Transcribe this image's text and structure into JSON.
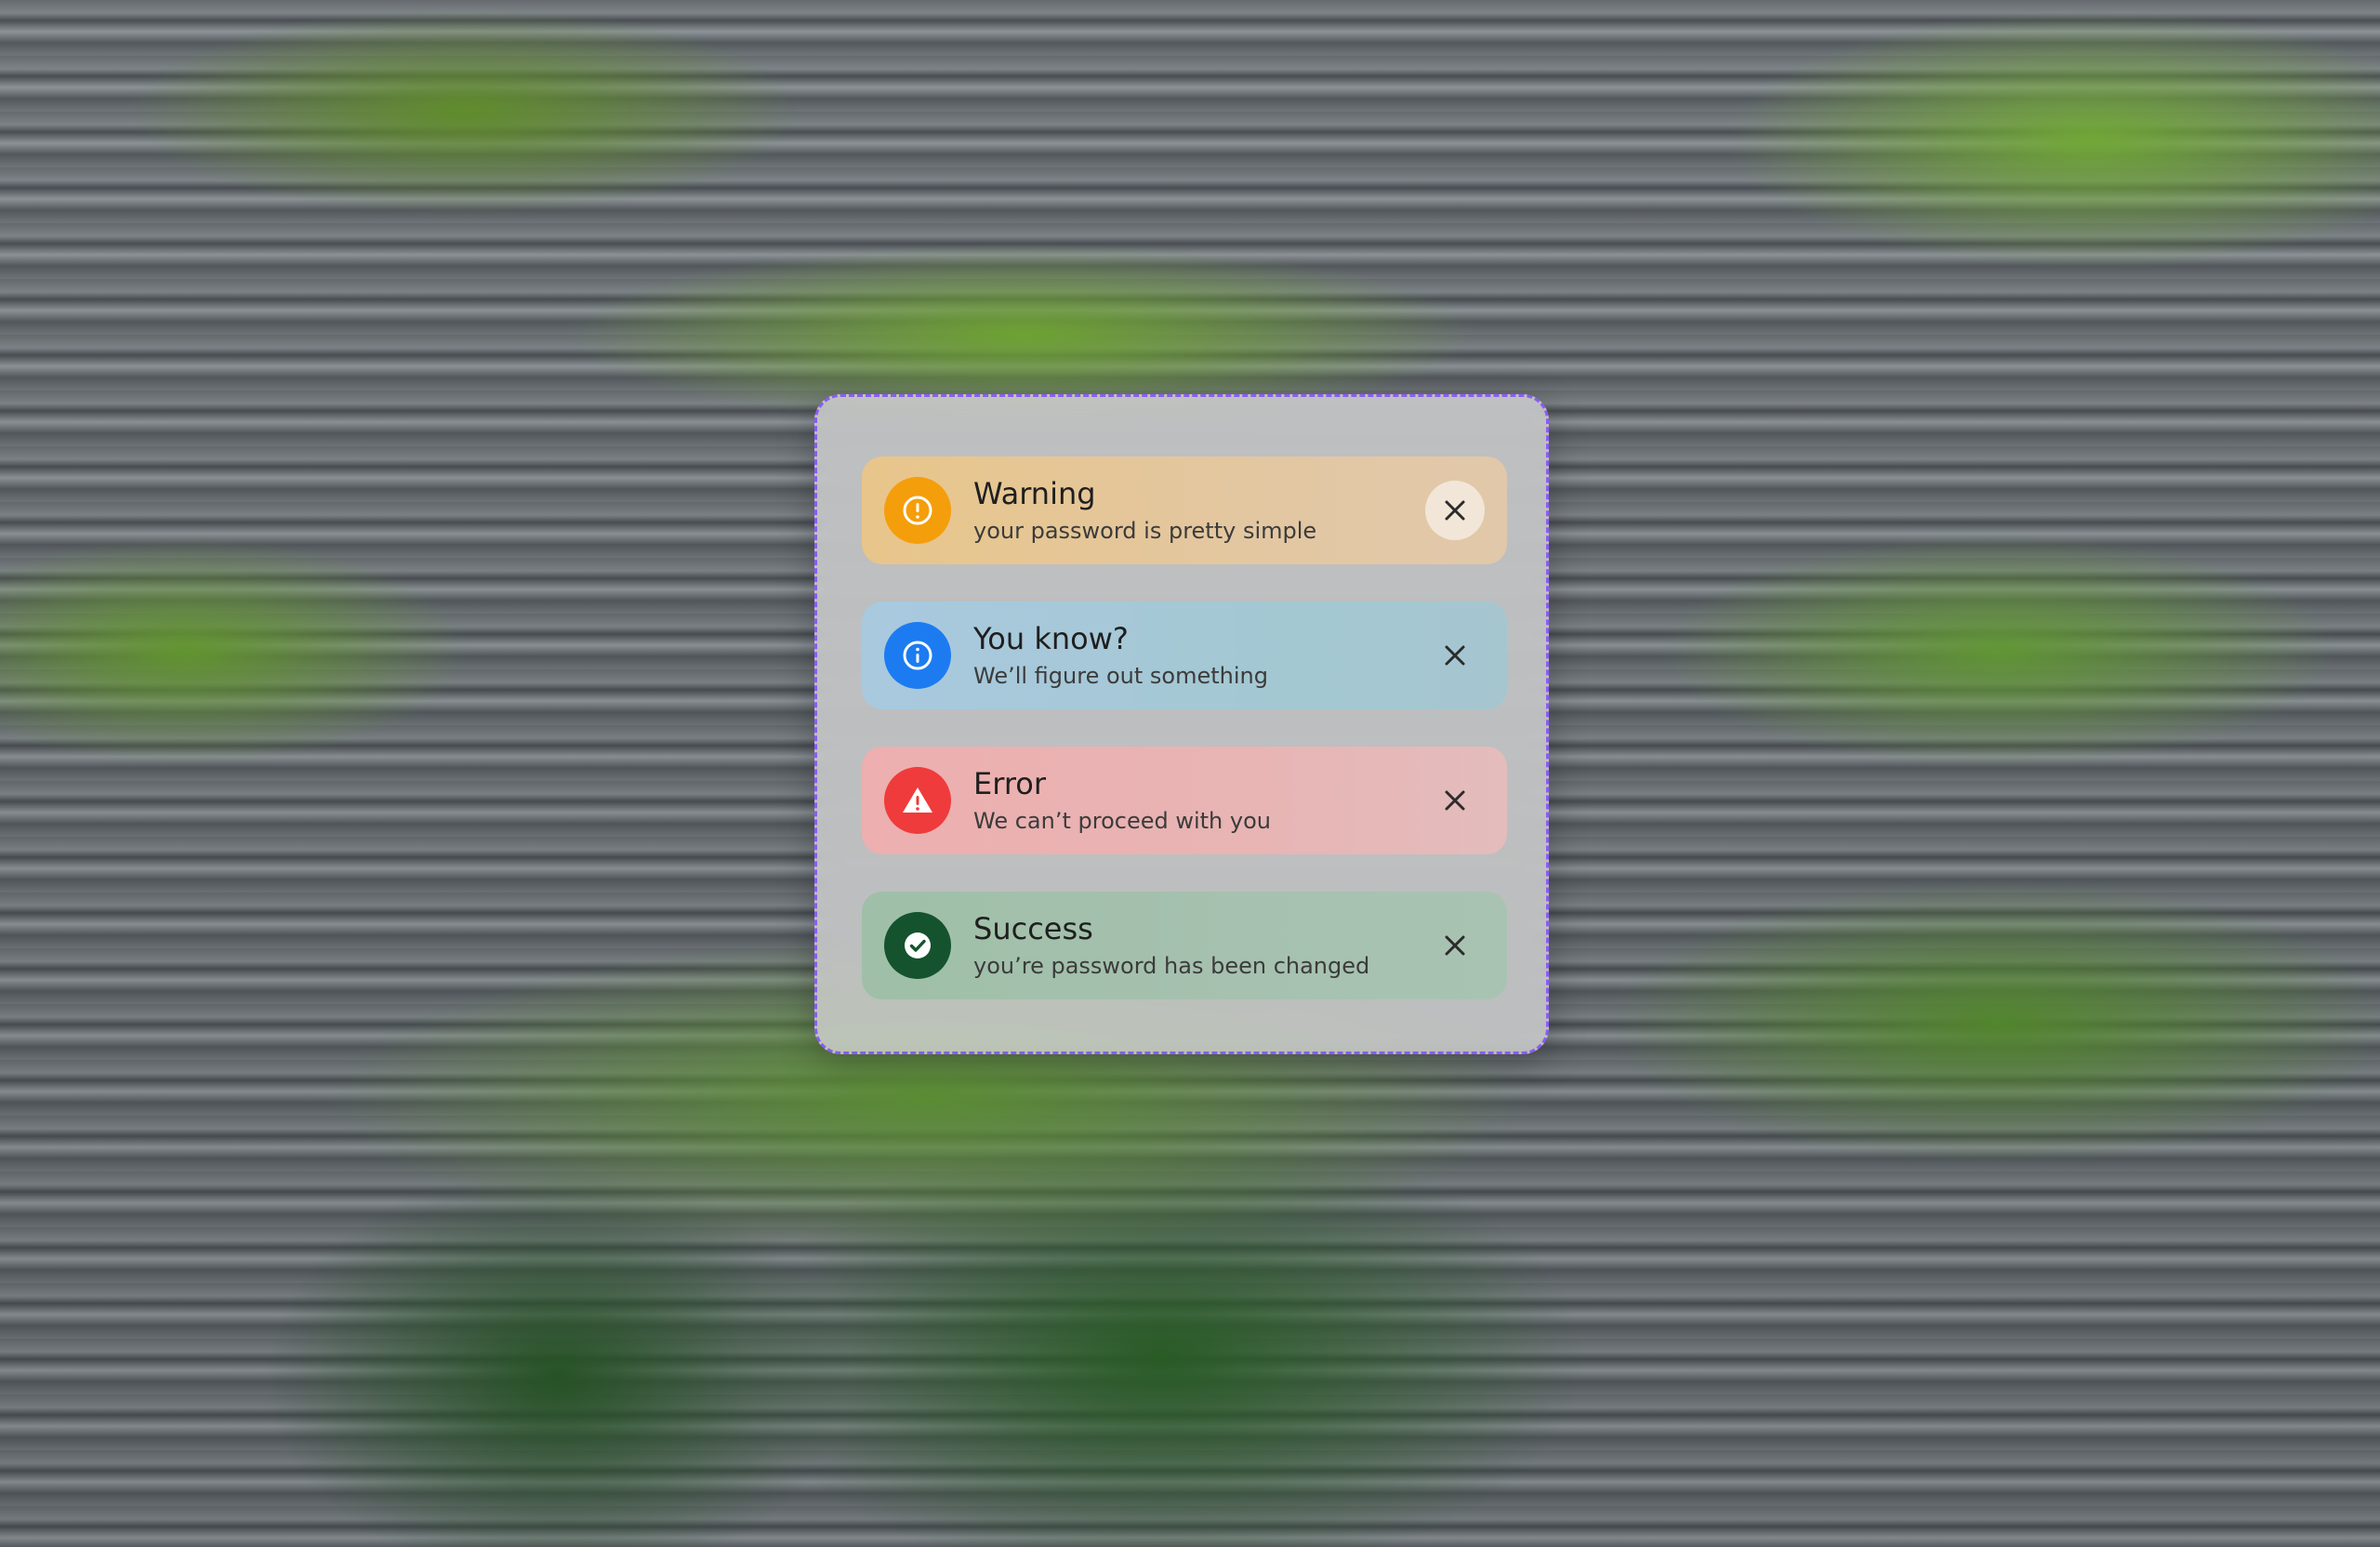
{
  "colors": {
    "panel_border": "#8b5cf6",
    "warning": "#f59e0b",
    "info": "#1d7bf2",
    "error": "#ef3b3b",
    "success": "#14532d"
  },
  "notifications": [
    {
      "type": "warning",
      "icon": "exclamation-circle-icon",
      "title": "Warning",
      "message": "your password is pretty simple"
    },
    {
      "type": "info",
      "icon": "info-circle-icon",
      "title": "You know?",
      "message": "We’ll figure out something"
    },
    {
      "type": "error",
      "icon": "warning-triangle-icon",
      "title": "Error",
      "message": "We can’t proceed with you"
    },
    {
      "type": "success",
      "icon": "check-circle-icon",
      "title": "Success",
      "message": "you’re password has been changed"
    }
  ]
}
